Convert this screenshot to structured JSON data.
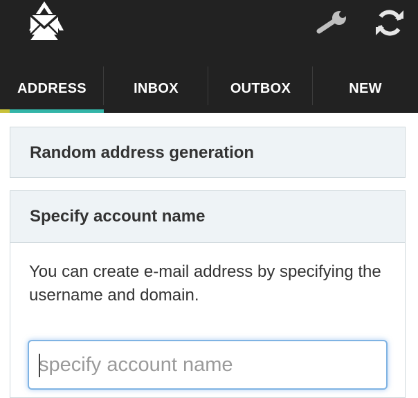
{
  "tabs": [
    {
      "label": "ADDRESS",
      "active": true
    },
    {
      "label": "INBOX",
      "active": false
    },
    {
      "label": "OUTBOX",
      "active": false
    },
    {
      "label": "NEW",
      "active": false
    }
  ],
  "toolbar": {
    "logo_icon": "recycle-mail-logo-icon",
    "settings_icon": "wrench-icon",
    "refresh_icon": "refresh-icon"
  },
  "panels": {
    "random": {
      "title": "Random address generation"
    },
    "specify": {
      "title": "Specify account name",
      "description": "You can create e-mail address by specifying the username and domain.",
      "input_placeholder": "specify account name",
      "input_value": ""
    }
  },
  "colors": {
    "appbar_bg": "#222222",
    "tab_indicator": "#33b5a8",
    "panel_bg": "#eef3f6",
    "input_focus": "#7fb3e3"
  }
}
